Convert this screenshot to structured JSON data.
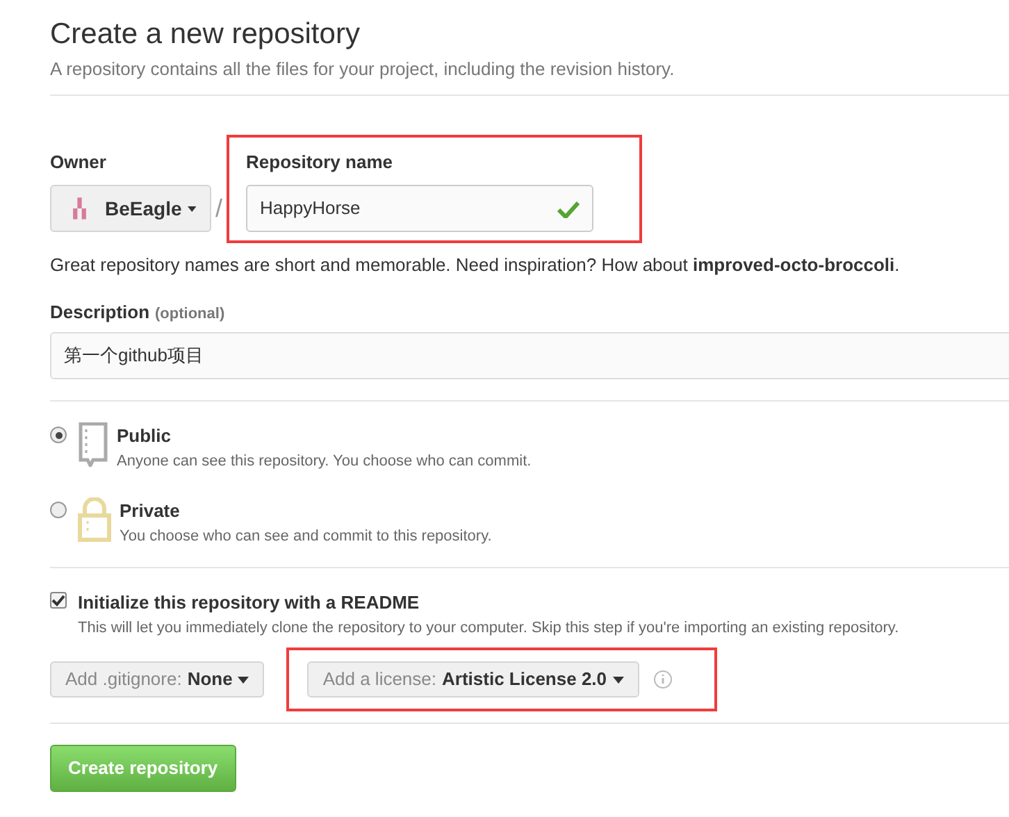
{
  "heading": {
    "title": "Create a new repository",
    "subtitle": "A repository contains all the files for your project, including the revision history."
  },
  "owner": {
    "label": "Owner",
    "value": "BeEagle"
  },
  "separator": "/",
  "repository_name": {
    "label": "Repository name",
    "value": "HappyHorse",
    "valid": true,
    "highlighted": true
  },
  "name_hint": "Great repository names are short and memorable. Need inspiration? How about **improved-octo-broccoli**.",
  "description": {
    "label": "Description",
    "optional": "(optional)",
    "value": "第一个github项目"
  },
  "visibility": [
    {
      "kind": "public",
      "title": "Public",
      "text": "Anyone can see this repository. You choose who can commit.",
      "selected": true
    },
    {
      "kind": "private",
      "title": "Private",
      "text": "You choose who can see and commit to this repository.",
      "selected": false
    }
  ],
  "init_readme": {
    "label": "Initialize this repository with a README",
    "text": "This will let you immediately clone the repository to your computer. Skip this step if you're importing an existing repository.",
    "checked": true
  },
  "gitignore": {
    "label": "Add .gitignore:",
    "value": "None"
  },
  "license": {
    "label": "Add a license:",
    "value": "Artistic License 2.0",
    "highlighted": true
  },
  "submit": "Create repository"
}
